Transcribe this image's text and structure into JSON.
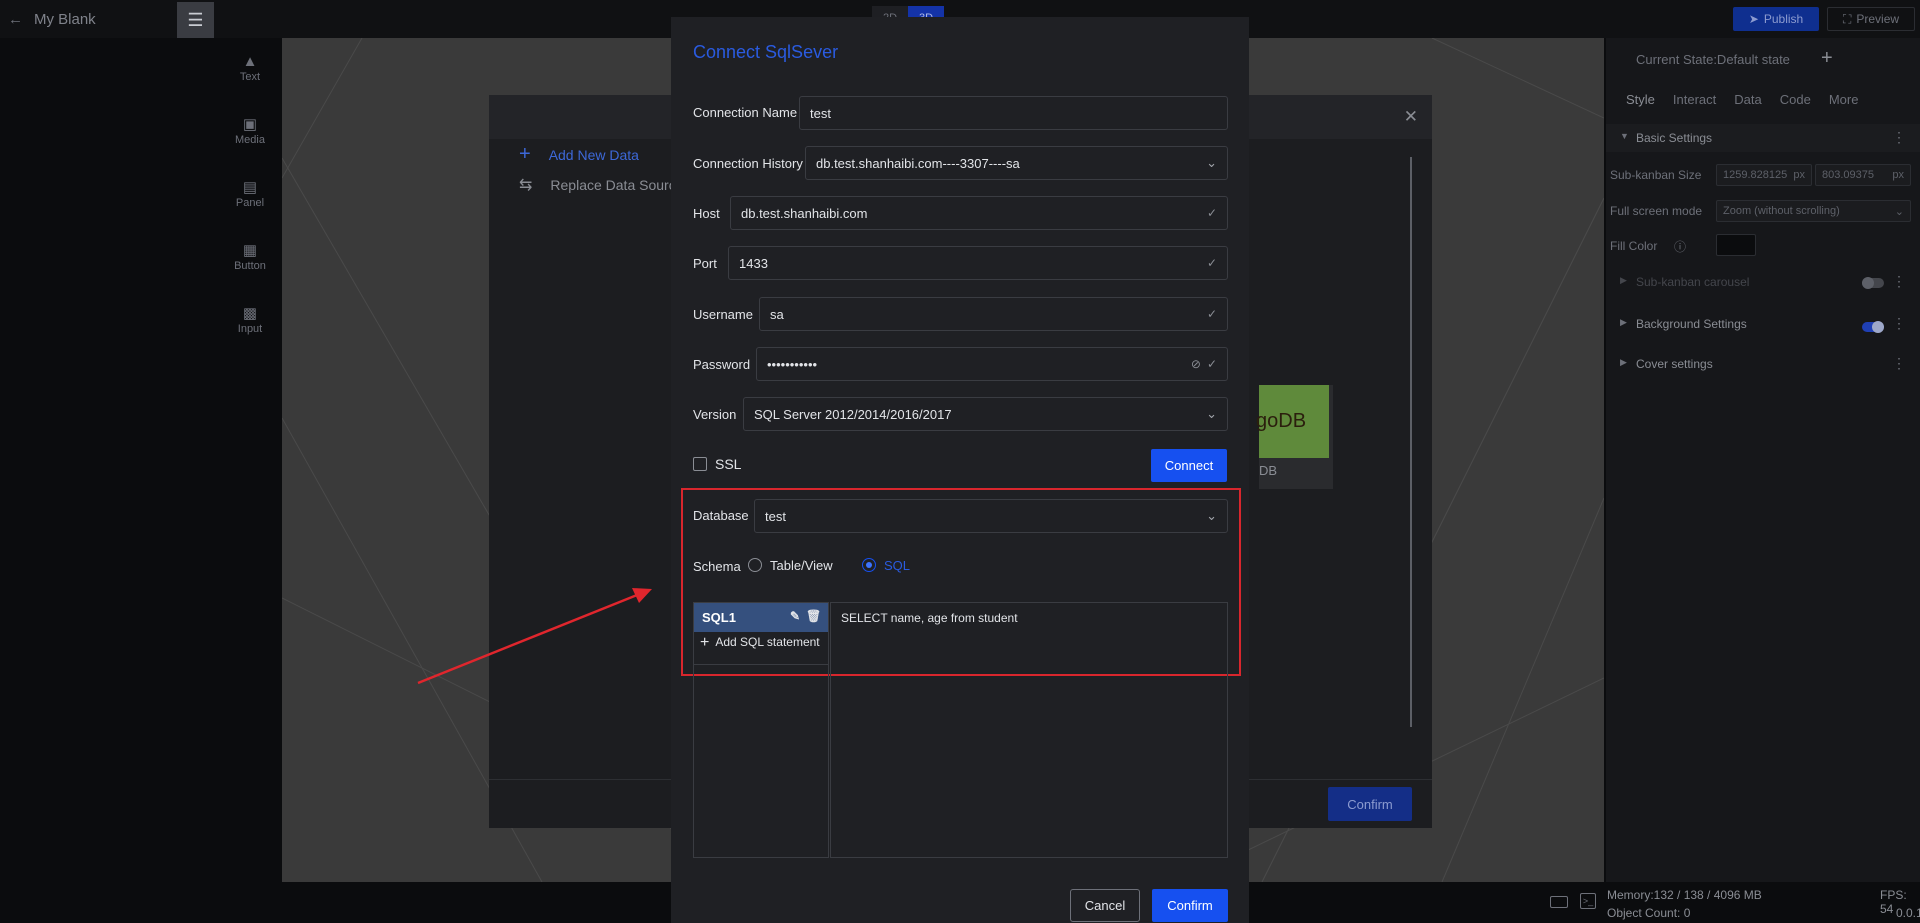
{
  "app": {
    "title": "My Blank",
    "menu_icon": "hamburger-icon"
  },
  "mode_switch": {
    "tabs": [
      "2D",
      "3D"
    ],
    "active": "3D"
  },
  "header": {
    "publish_label": "Publish",
    "preview_label": "Preview"
  },
  "left_toolbar": {
    "items": [
      {
        "label": "Text",
        "icon": "text-icon"
      },
      {
        "label": "Media",
        "icon": "media-icon"
      },
      {
        "label": "Panel",
        "icon": "panel-icon"
      },
      {
        "label": "Button",
        "icon": "button-icon"
      },
      {
        "label": "Input",
        "icon": "input-icon"
      }
    ]
  },
  "data_dialog": {
    "add_label": "Add New Data",
    "replace_label": "Replace Data Source",
    "mongo_label": "DB",
    "mongo_logo_text": "goDB",
    "confirm_label": "Confirm"
  },
  "right_panel": {
    "state_label": "Current State:Default state",
    "tabs": [
      "Style",
      "Interact",
      "Data",
      "Code",
      "More"
    ],
    "active_tab": "Style",
    "basic_settings": "Basic Settings",
    "sub_kanban_size_label": "Sub-kanban Size",
    "width_value": "1259.828125",
    "height_value": "803.09375",
    "unit": "px",
    "fullscreen_label": "Full screen mode",
    "fullscreen_value": "Zoom (without scrolling)",
    "fill_color_label": "Fill Color",
    "carousel_label": "Sub-kanban carousel",
    "background_label": "Background Settings",
    "cover_label": "Cover settings"
  },
  "connect_dialog": {
    "title": "Connect SqlSever",
    "connection_name": {
      "label": "Connection Name",
      "value": "test"
    },
    "connection_history": {
      "label": "Connection History",
      "value": "db.test.shanhaibi.com----3307----sa"
    },
    "host": {
      "label": "Host",
      "value": "db.test.shanhaibi.com"
    },
    "port": {
      "label": "Port",
      "value": "1433"
    },
    "username": {
      "label": "Username",
      "value": "sa"
    },
    "password": {
      "label": "Password",
      "value": "•••••••••••"
    },
    "version": {
      "label": "Version",
      "value": "SQL Server 2012/2014/2016/2017"
    },
    "ssl_label": "SSL",
    "ssl_checked": false,
    "connect_label": "Connect",
    "database": {
      "label": "Database",
      "value": "test"
    },
    "schema": {
      "label": "Schema",
      "option_table": "Table/View",
      "option_sql": "SQL",
      "selected": "SQL"
    },
    "sql_items": [
      {
        "label": "SQL1"
      }
    ],
    "add_sql_label": "Add SQL statement",
    "sql_text": "SELECT name, age from student",
    "cancel_label": "Cancel",
    "confirm_label": "Confirm"
  },
  "status_bar": {
    "memory": "Memory:132 / 138 / 4096 MB",
    "object_count": "Object Count: 0",
    "fps": "FPS: 54",
    "version": "0.0.1"
  },
  "colors": {
    "accent": "#1650f0",
    "highlight_box": "#d8262d",
    "annotation_arrow": "#e0262d"
  }
}
